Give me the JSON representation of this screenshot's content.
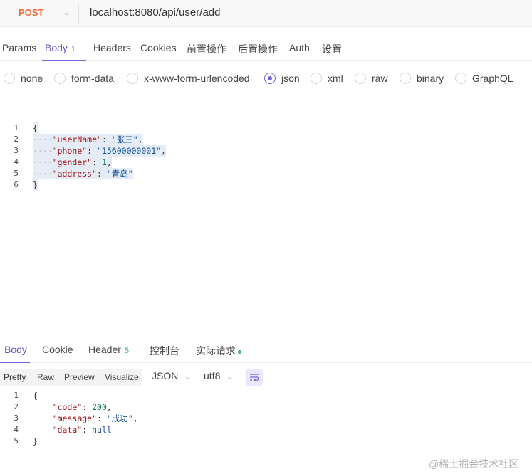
{
  "request": {
    "method": "POST",
    "url": "localhost:8080/api/user/add",
    "tabs": [
      {
        "label": "Params",
        "badge": ""
      },
      {
        "label": "Body",
        "badge": "1"
      },
      {
        "label": "Headers",
        "badge": ""
      },
      {
        "label": "Cookies",
        "badge": ""
      },
      {
        "label": "前置操作",
        "badge": ""
      },
      {
        "label": "后置操作",
        "badge": ""
      },
      {
        "label": "Auth",
        "badge": ""
      },
      {
        "label": "设置",
        "badge": ""
      }
    ],
    "active_tab": "Body",
    "body_types": [
      "none",
      "form-data",
      "x-www-form-urlencoded",
      "json",
      "xml",
      "raw",
      "binary",
      "GraphQL"
    ],
    "selected_body_type": "json",
    "body_lines": [
      {
        "n": "1",
        "text": "{"
      },
      {
        "n": "2",
        "key": "\"userName\"",
        "value": "\"张三\"",
        "comma": ","
      },
      {
        "n": "3",
        "key": "\"phone\"",
        "value": "\"15600000001\"",
        "comma": ","
      },
      {
        "n": "4",
        "key": "\"gender\"",
        "value": "1",
        "comma": ","
      },
      {
        "n": "5",
        "key": "\"address\"",
        "value": "\"青岛\"",
        "comma": ""
      },
      {
        "n": "6",
        "text": "}"
      }
    ]
  },
  "response": {
    "tabs": [
      {
        "label": "Body",
        "badge": ""
      },
      {
        "label": "Cookie",
        "badge": ""
      },
      {
        "label": "Header",
        "badge": "5"
      },
      {
        "label": "控制台",
        "badge": ""
      },
      {
        "label": "实际请求",
        "badge": ""
      }
    ],
    "active_tab": "Body",
    "formats": [
      "Pretty",
      "Raw",
      "Preview",
      "Visualize"
    ],
    "active_format": "Pretty",
    "language": "JSON",
    "encoding": "utf8",
    "body_lines": [
      {
        "n": "1",
        "text": "{"
      },
      {
        "n": "2",
        "key": "\"code\"",
        "value": "200",
        "comma": ","
      },
      {
        "n": "3",
        "key": "\"message\"",
        "value": "\"成功\"",
        "comma": ","
      },
      {
        "n": "4",
        "key": "\"data\"",
        "value": "null",
        "comma": ""
      },
      {
        "n": "5",
        "text": "}"
      }
    ]
  },
  "watermark": "@稀土掘金技术社区",
  "colors": {
    "accent": "#7a5ed6",
    "method_post": "#ef6c3c",
    "badge_green": "#3db37a"
  }
}
